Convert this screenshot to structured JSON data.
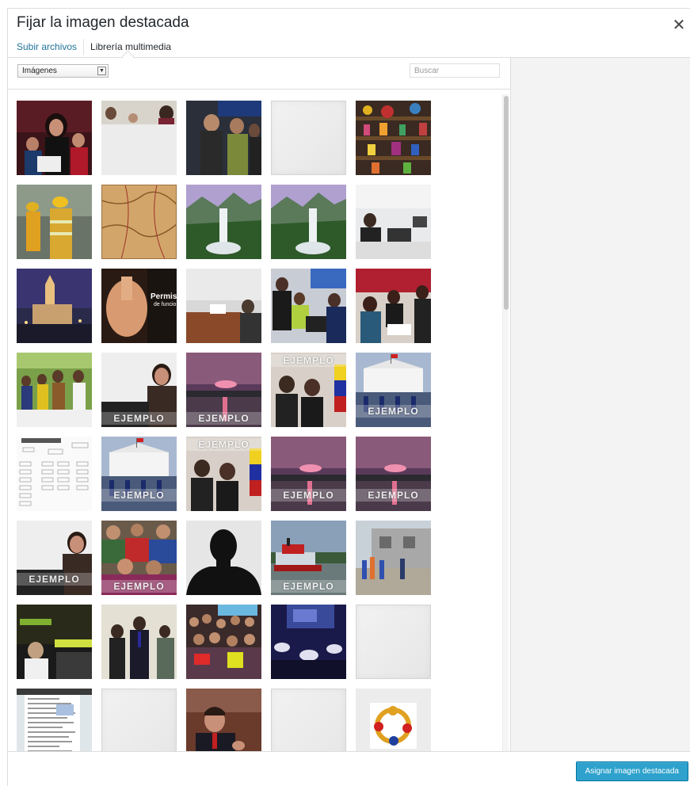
{
  "modal": {
    "title": "Fijar la imagen destacada",
    "close_icon": "close-icon"
  },
  "router": {
    "tabs": [
      {
        "label": "Subir archivos",
        "active": false
      },
      {
        "label": "Librería multimedia",
        "active": true
      }
    ]
  },
  "toolbar": {
    "filter_selected": "Imágenes",
    "search_placeholder": "Buscar"
  },
  "attachments": {
    "watermark": "EJEMPLO",
    "permit_text": "Permiso",
    "permit_subtext": "de funcio"
  },
  "footer": {
    "primary_button": "Asignar imagen destacada"
  },
  "colors": {
    "link": "#21759b",
    "primary": "#2ea2cc",
    "primary_border": "#0074a2"
  }
}
